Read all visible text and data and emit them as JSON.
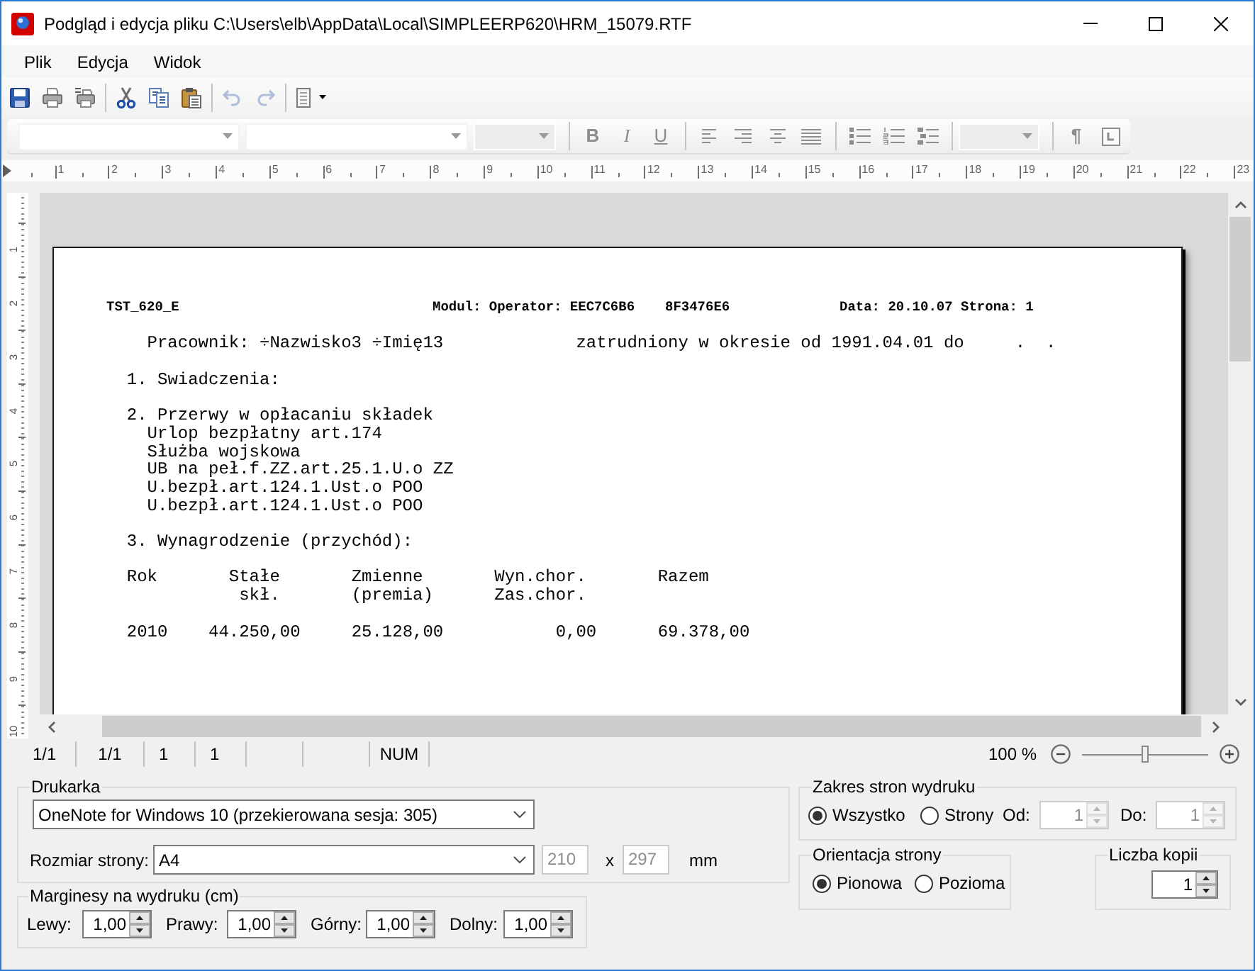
{
  "window": {
    "title": "Podgląd i edycja pliku C:\\Users\\elb\\AppData\\Local\\SIMPLEERP620\\HRM_15079.RTF"
  },
  "menu": [
    {
      "label": "Plik"
    },
    {
      "label": "Edycja"
    },
    {
      "label": "Widok"
    }
  ],
  "toolbar": {
    "groups": [
      [
        {
          "kind": "save",
          "disabled": false
        },
        {
          "kind": "print",
          "disabled": false
        },
        {
          "kind": "print_preview",
          "disabled": false
        }
      ],
      [
        {
          "kind": "cut",
          "disabled": false
        },
        {
          "kind": "copy",
          "disabled": false
        },
        {
          "kind": "paste",
          "disabled": false
        }
      ],
      [
        {
          "kind": "undo",
          "disabled": true
        },
        {
          "kind": "redo",
          "disabled": true
        }
      ],
      [
        {
          "kind": "page_view",
          "disabled": false
        }
      ]
    ]
  },
  "format_toolbar": {
    "groups": [
      [
        {
          "kind": "combo",
          "disabled": false
        },
        {
          "kind": "combo",
          "disabled": false
        },
        {
          "kind": "combo",
          "disabled": true
        }
      ],
      [
        {
          "kind": "bold",
          "label": "B",
          "disabled": true
        },
        {
          "kind": "italic",
          "label": "I",
          "disabled": true
        },
        {
          "kind": "underline",
          "label": "U",
          "disabled": true
        }
      ],
      [
        {
          "kind": "align_left",
          "disabled": true
        },
        {
          "kind": "align_right",
          "disabled": true
        },
        {
          "kind": "align_center",
          "disabled": true
        },
        {
          "kind": "justify",
          "disabled": true
        }
      ],
      [
        {
          "kind": "bullets",
          "disabled": true
        },
        {
          "kind": "numbering",
          "disabled": true
        },
        {
          "kind": "outline",
          "disabled": true
        }
      ],
      [
        {
          "kind": "combo",
          "disabled": true
        }
      ],
      [
        {
          "kind": "pilcrow",
          "label": "¶",
          "disabled": true
        },
        {
          "kind": "frame",
          "disabled": true
        }
      ]
    ]
  },
  "ruler": {
    "labels": [
      "1",
      "2",
      "3",
      "4",
      "5",
      "6",
      "7",
      "8",
      "9",
      "10",
      "11",
      "12",
      "13",
      "14",
      "15",
      "16",
      "17",
      "18",
      "19",
      "20",
      "21",
      "22",
      "23"
    ]
  },
  "vertical_ruler": {
    "labels": [
      "1",
      "2",
      "3",
      "4",
      "5",
      "6",
      "7",
      "8",
      "9",
      "10"
    ]
  },
  "document": {
    "header": {
      "report_id": "TST_620_E",
      "operator": "Modul: Operator: EEC7C6B6",
      "operator_code": "8F3476E6",
      "date_page": "Data: 20.10.07 Strona: 1"
    },
    "employee": {
      "name": "Pracownik: ÷Nazwisko3 ÷Imię13",
      "period": "zatrudniony w okresie od 1991.04.01 do",
      "date_to": ".  ."
    },
    "sections": [
      {
        "title": "1. Swiadczenia:"
      },
      {
        "title": "2. Przerwy w opłacaniu składek",
        "items": [
          "Urlop bezpłatny art.174",
          "Służba wojskowa",
          "UB na peł.f.ZZ.art.25.1.U.o ZZ",
          "U.bezpł.art.124.1.Ust.o POO",
          "U.bezpł.art.124.1.Ust.o POO"
        ]
      },
      {
        "title": "3. Wynagrodzenie (przychód):",
        "table": {
          "columns": [
            {
              "lines": [
                "Rok"
              ]
            },
            {
              "lines": [
                "Stałe",
                "skł."
              ]
            },
            {
              "lines": [
                "Zmienne",
                "(premia)"
              ]
            },
            {
              "lines": [
                "Wyn.chor.",
                "Zas.chor."
              ]
            },
            {
              "lines": [
                "Razem"
              ]
            }
          ],
          "rows": [
            [
              "2010",
              "44.250,00",
              "25.128,00",
              "0,00",
              "69.378,00"
            ]
          ]
        }
      }
    ]
  },
  "status_bar": {
    "cells": [
      "1/1",
      "1/1",
      "1",
      "1"
    ],
    "num_lock": "NUM",
    "zoom": {
      "reading": "100 %",
      "level": 0.5
    }
  },
  "print_settings": {
    "printer": {
      "legend": "Drukarka",
      "value": "OneNote for Windows 10 (przekierowana sesja: 305)"
    },
    "page_size": {
      "label": "Rozmiar strony:",
      "value": "A4",
      "width": {
        "value": "210",
        "disabled": true
      },
      "times": "x",
      "height": {
        "value": "297",
        "disabled": true
      },
      "unit": "mm"
    },
    "margins": {
      "legend": "Marginesy na wydruku (cm)",
      "fields": [
        {
          "label": "Lewy:",
          "value": "1,00"
        },
        {
          "label": "Prawy:",
          "value": "1,00"
        },
        {
          "label": "Górny:",
          "value": "1,00"
        },
        {
          "label": "Dolny:",
          "value": "1,00"
        }
      ]
    },
    "page_range": {
      "legend": "Zakres stron wydruku",
      "options": [
        {
          "label": "Wszystko",
          "selected": true
        },
        {
          "label": "Strony",
          "selected": false
        }
      ],
      "from": {
        "label": "Od:",
        "value": "1",
        "disabled": true
      },
      "to": {
        "label": "Do:",
        "value": "1",
        "disabled": true
      }
    },
    "orientation": {
      "legend": "Orientacja strony",
      "options": [
        {
          "label": "Pionowa",
          "selected": true
        },
        {
          "label": "Pozioma",
          "selected": false
        }
      ]
    },
    "copies": {
      "legend": "Liczba kopii",
      "value": "1"
    }
  }
}
